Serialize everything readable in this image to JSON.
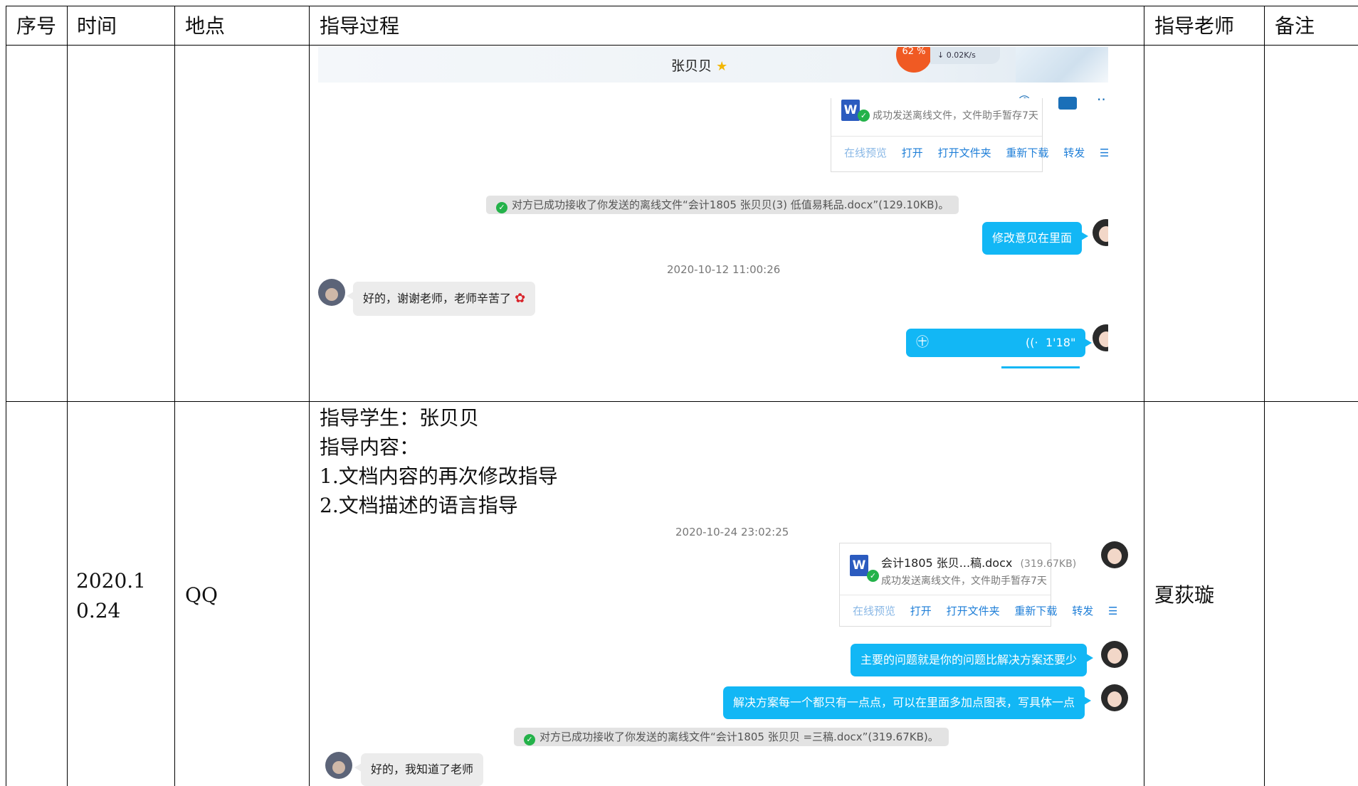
{
  "table": {
    "headers": {
      "index": "序号",
      "time": "时间",
      "place": "地点",
      "process": "指导过程",
      "teacher": "指导老师",
      "remark": "备注"
    },
    "row2": {
      "date": "2020.10.24",
      "place": "QQ",
      "teacher": "夏荻璇",
      "process_lines": [
        "指导学生：张贝贝",
        "指导内容：",
        "1.文档内容的再次修改指导",
        "2.文档描述的语言指导"
      ]
    }
  },
  "chat1": {
    "contact_name": "张贝贝",
    "speed_label": "0.02K/s",
    "cpu_badge": "62 %",
    "file_status": "成功发送离线文件，文件助手暂存7天",
    "file_actions": [
      "在线预览",
      "打开",
      "打开文件夹",
      "重新下载",
      "转发"
    ],
    "notice": "对方已成功接收了你发送的离线文件“会计1805 张贝贝(3) 低值易耗品.docx”(129.10KB)。",
    "msg_out_1": "修改意见在里面",
    "timestamp": "2020-10-12 11:00:26",
    "msg_in_1": "好的，谢谢老师，老师辛苦了",
    "voice_duration": "1'18\""
  },
  "chat2": {
    "timestamp": "2020-10-24 23:02:25",
    "file_name": "会计1805 张贝...稿.docx",
    "file_size": "(319.67KB)",
    "file_status": "成功发送离线文件，文件助手暂存7天",
    "file_actions": [
      "在线预览",
      "打开",
      "打开文件夹",
      "重新下载",
      "转发"
    ],
    "msg_out_1": "主要的问题就是你的问题比解决方案还要少",
    "msg_out_2": "解决方案每一个都只有一点点，可以在里面多加点图表，写具体一点",
    "notice": "对方已成功接收了你发送的离线文件“会计1805 张贝贝 =三稿.docx”(319.67KB)。",
    "msg_in_1": "好的，我知道了老师"
  },
  "colors": {
    "bubble_out": "#12b7f5",
    "bubble_in": "#ececec",
    "link": "#1f7fd8",
    "ok_green": "#24b24a",
    "badge_orange": "#f05a23"
  }
}
